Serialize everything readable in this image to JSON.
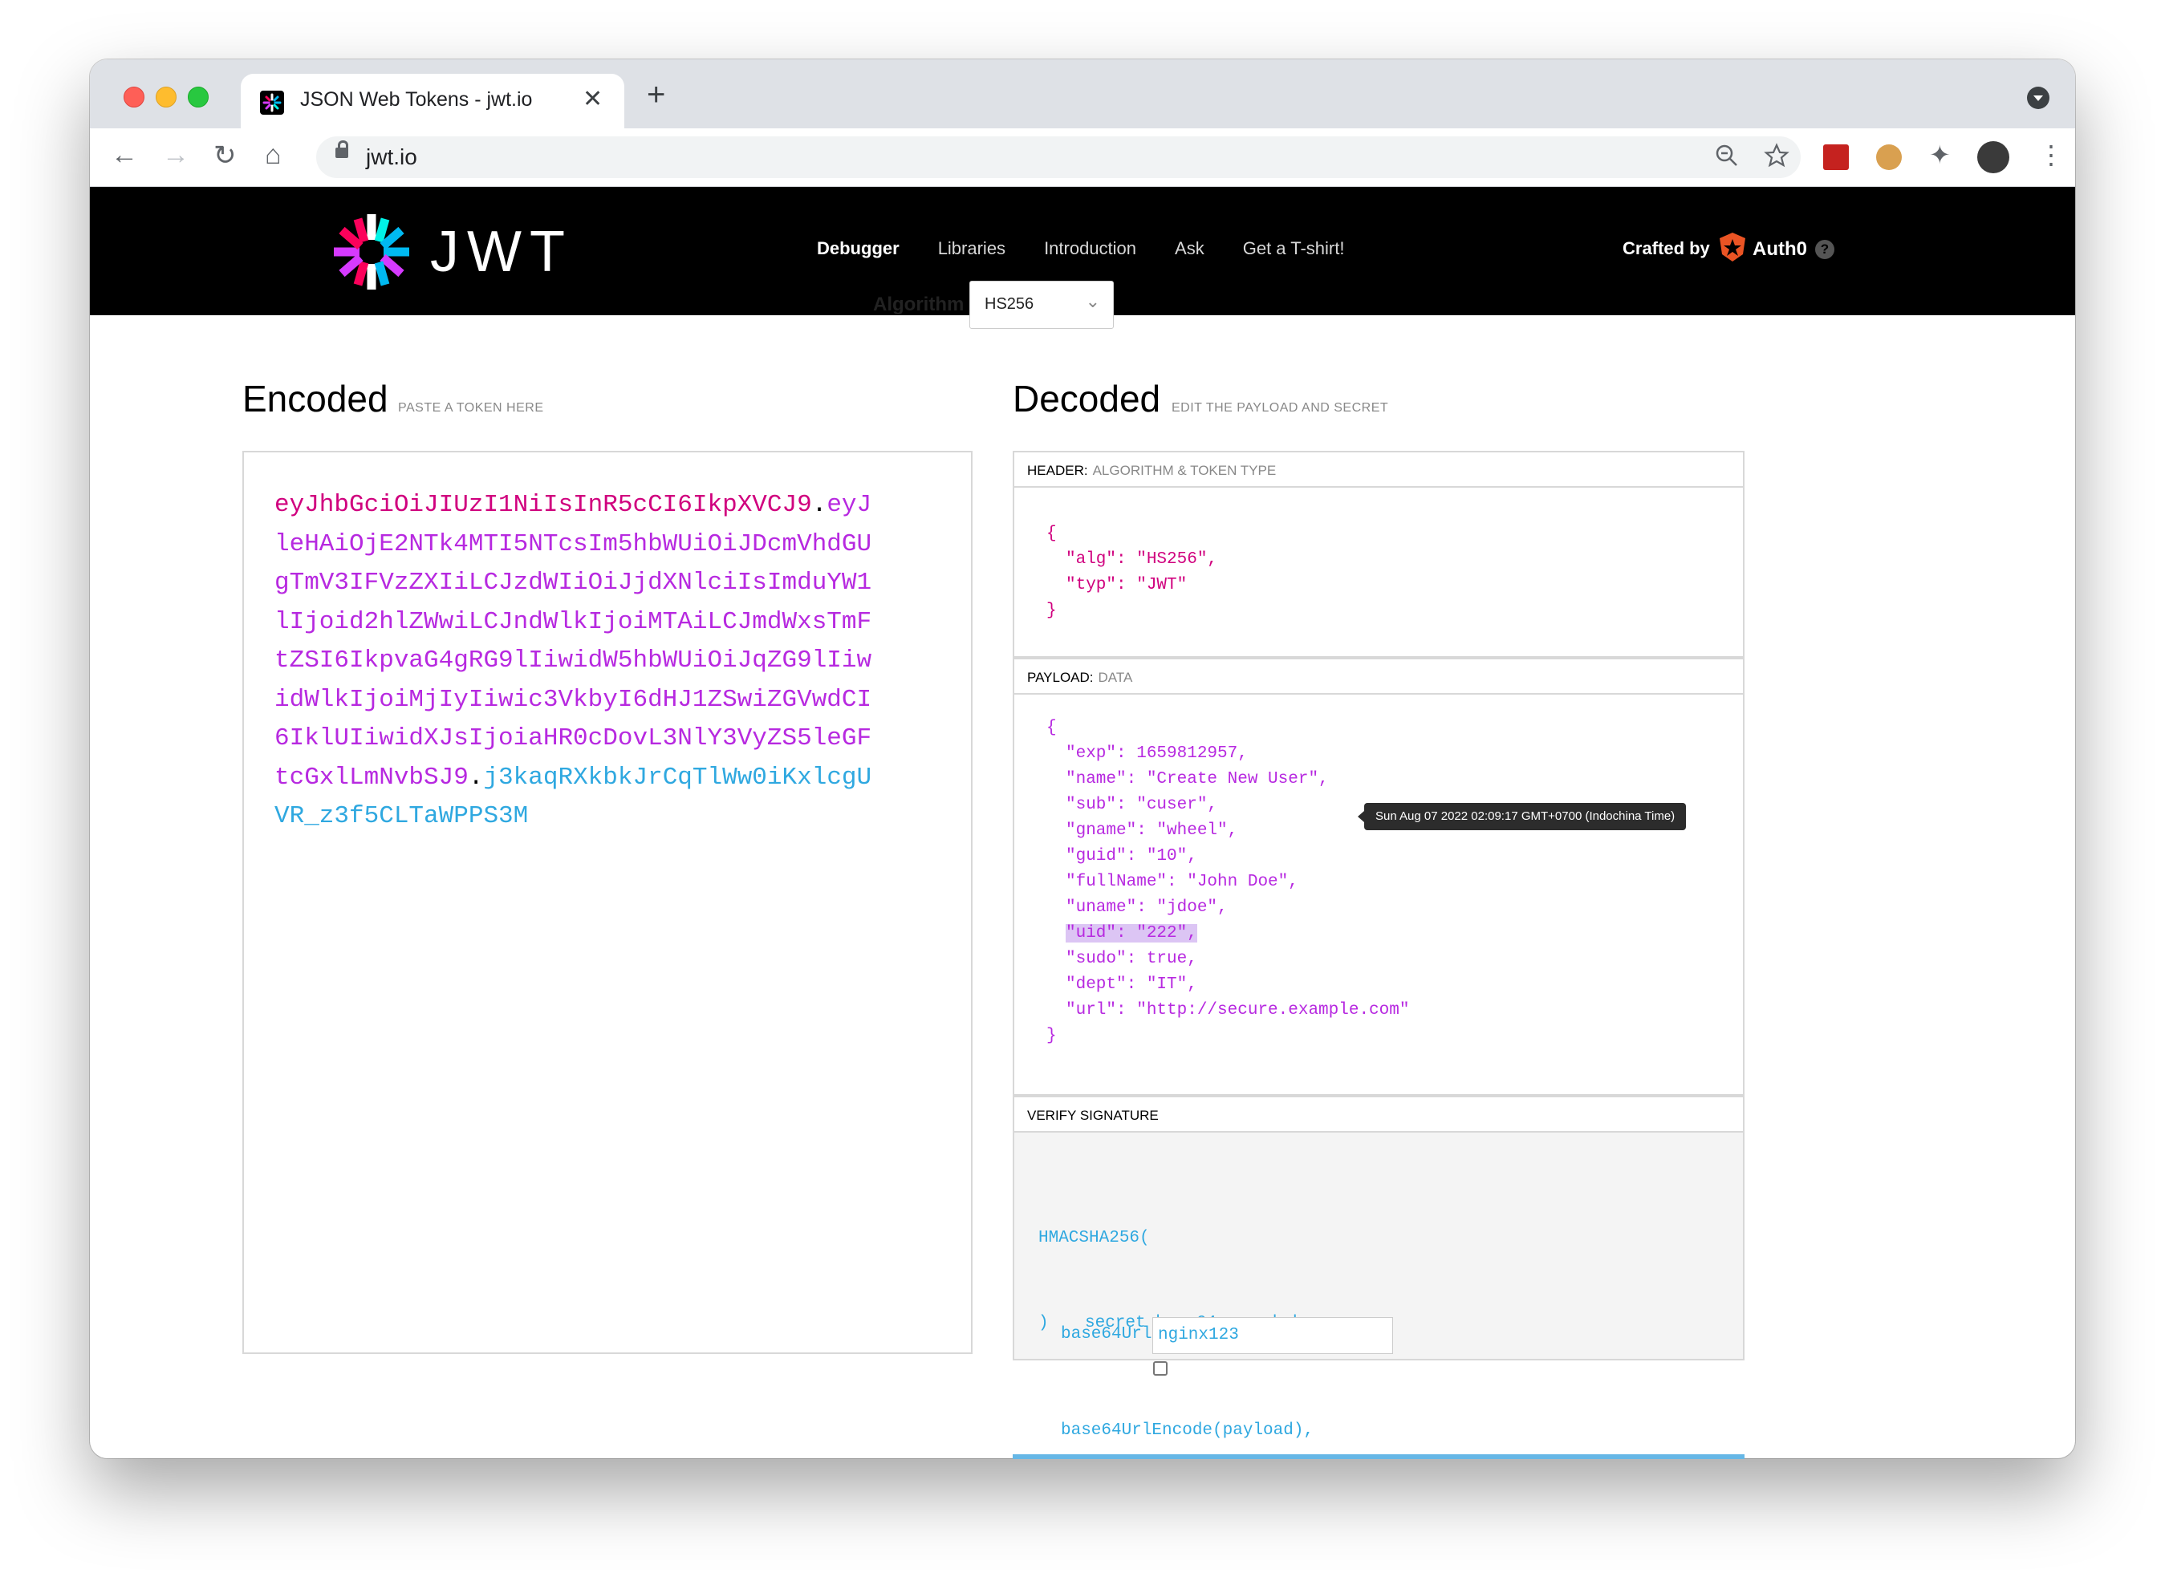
{
  "browser": {
    "tab_title": "JSON Web Tokens - jwt.io",
    "tab_close": "✕",
    "new_tab": "+",
    "url": "jwt.io",
    "nav": {
      "back": "←",
      "forward": "→",
      "reload": "↻",
      "home": "⌂"
    },
    "icons": {
      "zoom": "zoom-icon",
      "star": "star-icon",
      "menu": "⋮",
      "puzzle": "✦"
    }
  },
  "site": {
    "logo_text": "JWT",
    "nav": [
      {
        "label": "Debugger",
        "active": true
      },
      {
        "label": "Libraries",
        "active": false
      },
      {
        "label": "Introduction",
        "active": false
      },
      {
        "label": "Ask",
        "active": false
      },
      {
        "label": "Get a T-shirt!",
        "active": false
      }
    ],
    "crafted_by": "Crafted by",
    "auth0": "Auth0",
    "help": "?"
  },
  "algorithm": {
    "label": "Algorithm",
    "value": "HS256"
  },
  "encoded": {
    "title": "Encoded",
    "subtitle": "PASTE A TOKEN HERE",
    "header_seg": "eyJhbGciOiJIUzI1NiIsInR5cCI6IkpXVCJ9",
    "payload_seg": "eyJleHAiOjE2NTk4MTI5NTcsIm5hbWUiOiJDcmVhdGUgTmV3IFVzZXIiLCJzdWIiOiJjdXNlciIsImduYW1lIjoid2hlZWwiLCJndWlkIjoiMTAiLCJmdWxsTmFtZSI6IkpvaG4gRG9lIiwidW5hbWUiOiJqZG9lIiwidWlkIjoiMjIyIiwic3VkbyI6dHJ1ZSwiZGVwdCI6IklUIiwidXJsIjoiaHR0cDovL3NlY3VyZS5leGFtcGxlLmNvbSJ9",
    "signature_seg": "j3kaqRXkbkJrCqTlWw0iKxlcgUVR_z3f5CLTaWPPS3M",
    "dot": "."
  },
  "decoded": {
    "title": "Decoded",
    "subtitle": "EDIT THE PAYLOAD AND SECRET",
    "header_label": "HEADER:",
    "header_sublabel": "ALGORITHM & TOKEN TYPE",
    "header_json": [
      {
        "key": "alg",
        "value": "\"HS256\""
      },
      {
        "key": "typ",
        "value": "\"JWT\""
      }
    ],
    "payload_label": "PAYLOAD:",
    "payload_sublabel": "DATA",
    "payload_json": [
      {
        "key": "exp",
        "value": "1659812957"
      },
      {
        "key": "name",
        "value": "\"Create New User\""
      },
      {
        "key": "sub",
        "value": "\"cuser\""
      },
      {
        "key": "gname",
        "value": "\"wheel\""
      },
      {
        "key": "guid",
        "value": "\"10\""
      },
      {
        "key": "fullName",
        "value": "\"John Doe\""
      },
      {
        "key": "uname",
        "value": "\"jdoe\""
      },
      {
        "key": "uid",
        "value": "\"222\"",
        "highlighted": true
      },
      {
        "key": "sudo",
        "value": "true"
      },
      {
        "key": "dept",
        "value": "\"IT\""
      },
      {
        "key": "url",
        "value": "\"http://secure.example.com\""
      }
    ],
    "exp_tooltip": "Sun Aug 07 2022 02:09:17 GMT+0700 (Indochina Time)",
    "verify_label": "VERIFY SIGNATURE",
    "verify": {
      "fn": "HMACSHA256(",
      "line1": "base64UrlEncode(header) + \".\" +",
      "line2": "base64UrlEncode(payload),",
      "secret": "nginx123",
      "close": ")",
      "checkbox_label": "secret base64 encoded",
      "checkbox_checked": false
    }
  },
  "colors": {
    "header": "#d0007e",
    "payload": "#b729e0",
    "signature": "#2fa8e0"
  }
}
